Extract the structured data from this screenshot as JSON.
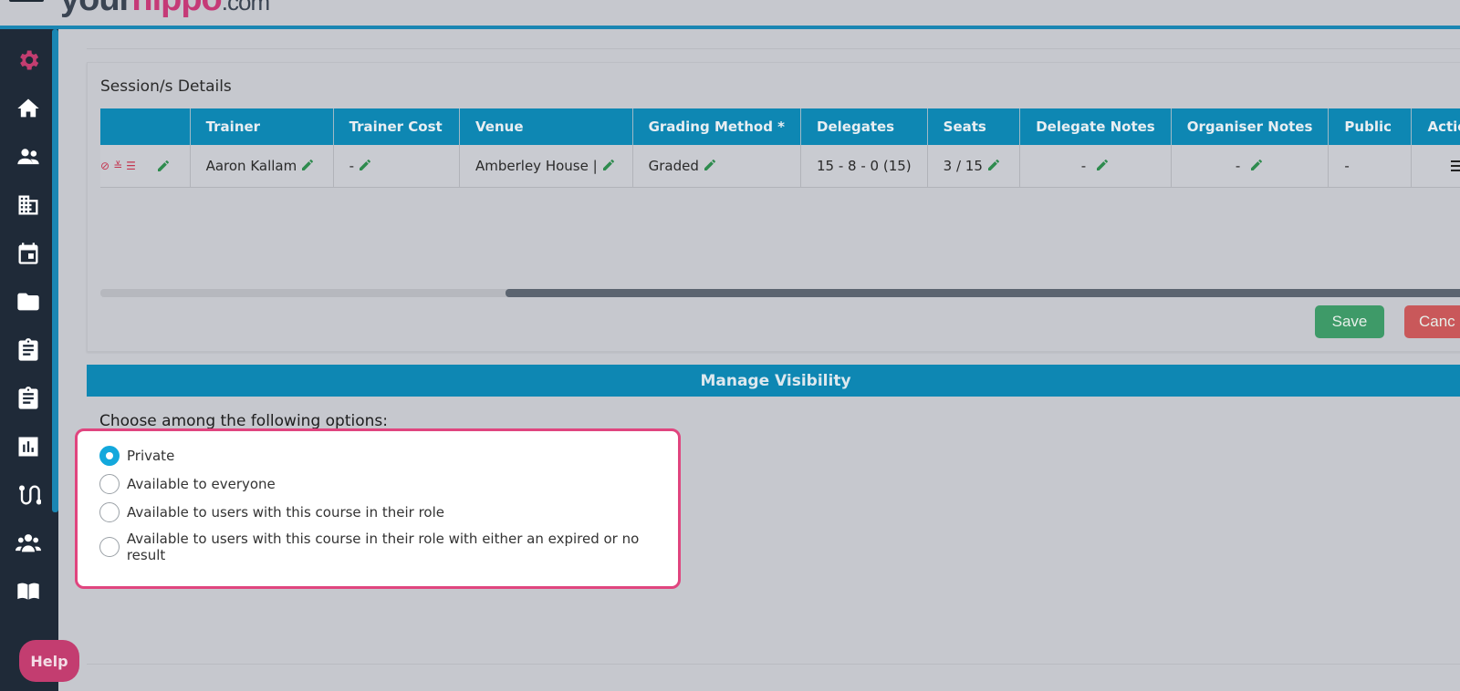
{
  "header": {
    "logo_parts": [
      "your",
      "hippo",
      ".com"
    ]
  },
  "sidebar": {
    "items": [
      {
        "icon": "gear-icon",
        "color": "#c33d70"
      },
      {
        "icon": "home-icon"
      },
      {
        "icon": "users-icon"
      },
      {
        "icon": "building-icon"
      },
      {
        "icon": "calendar-icon"
      },
      {
        "icon": "folder-icon"
      },
      {
        "icon": "clipboard-icon"
      },
      {
        "icon": "clipboard-list-icon"
      },
      {
        "icon": "bar-chart-icon"
      },
      {
        "icon": "route-icon"
      },
      {
        "icon": "group-icon"
      },
      {
        "icon": "book-icon"
      }
    ]
  },
  "sessions": {
    "title": "Session/s Details",
    "columns": [
      "",
      "Trainer",
      "Trainer Cost",
      "Venue",
      "Grading Method *",
      "Delegates",
      "Seats",
      "Delegate Notes",
      "Organiser Notes",
      "Public",
      "Actio"
    ],
    "row": {
      "trainer": "Aaron Kallam",
      "trainer_cost": "-",
      "venue": "Amberley House |",
      "grading_method": "Graded",
      "delegates": "15 - 8 - 0 (15)",
      "seats": "3 / 15",
      "delegate_notes": "-",
      "organiser_notes": "-",
      "public": "-"
    },
    "save_label": "Save",
    "cancel_label": "Canc"
  },
  "visibility": {
    "header": "Manage Visibility",
    "prompt": "Choose among the following options:",
    "options": [
      {
        "label": "Private",
        "selected": true
      },
      {
        "label": "Available to everyone",
        "selected": false
      },
      {
        "label": "Available to users with this course in their role",
        "selected": false
      },
      {
        "label": "Available to users with this course in their role with either an expired or no result",
        "selected": false
      }
    ]
  },
  "help": {
    "label": "Help"
  },
  "colors": {
    "accent": "#0e87b3",
    "brand": "#c33d70",
    "success": "#3e9a68",
    "danger": "#c9585a",
    "highlight": "#e0457f"
  }
}
